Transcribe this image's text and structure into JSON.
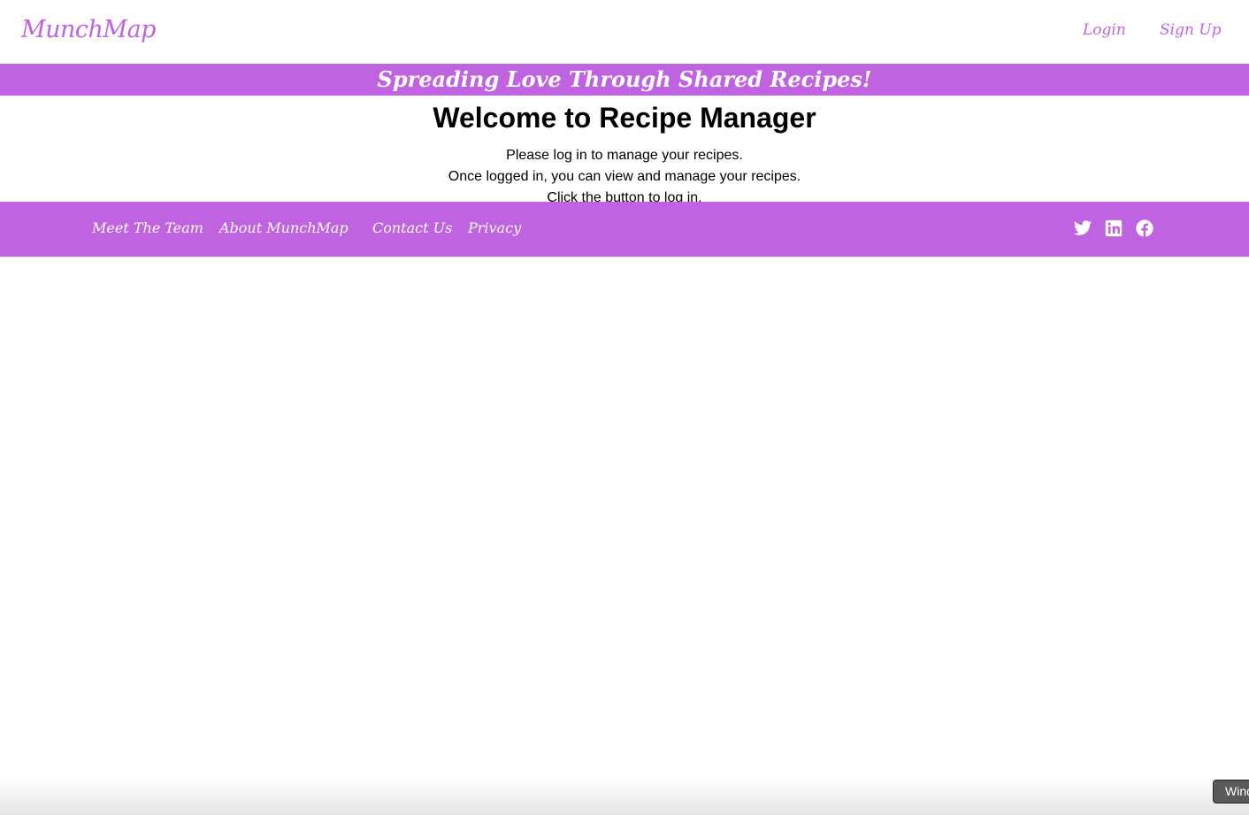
{
  "header": {
    "brand": "MunchMap",
    "login_label": "Login",
    "signup_label": "Sign Up"
  },
  "banner": {
    "text": "Spreading Love Through Shared Recipes!"
  },
  "main": {
    "title": "Welcome to Recipe Manager",
    "lines": [
      "Please log in to manage your recipes.",
      "Once logged in, you can view and manage your recipes.",
      "Click the button to log in."
    ]
  },
  "footer": {
    "links": [
      {
        "label": "Meet The Team"
      },
      {
        "label": "About MunchMap"
      },
      {
        "label": "Contact Us"
      },
      {
        "label": "Privacy"
      }
    ],
    "social_icons": [
      "twitter-icon",
      "linkedin-icon",
      "facebook-icon"
    ]
  },
  "overlay": {
    "button_label": "Wind"
  },
  "colors": {
    "accent": "#c063e0",
    "text": "#000000",
    "on_accent": "#ffffff"
  }
}
